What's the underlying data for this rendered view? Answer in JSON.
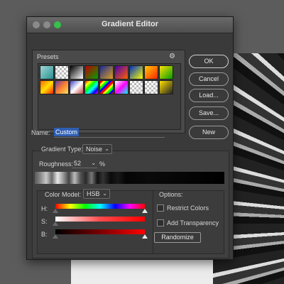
{
  "dialog": {
    "title": "Gradient Editor"
  },
  "presets": {
    "label": "Presets",
    "swatches": [
      {
        "name": "swatch-1",
        "bg": "linear-gradient(135deg,#9fd8d8,#2a9090)"
      },
      {
        "name": "swatch-2",
        "bg": "repeating-conic-gradient(#bbb 0 25%,#fff 0 50%) 0 0/6px 6px"
      },
      {
        "name": "swatch-3",
        "bg": "linear-gradient(135deg,#000,#fff)"
      },
      {
        "name": "swatch-4",
        "bg": "linear-gradient(135deg,#c00000,#00a000)"
      },
      {
        "name": "swatch-5",
        "bg": "linear-gradient(135deg,#1a2a90,#e0a020)"
      },
      {
        "name": "swatch-6",
        "bg": "linear-gradient(135deg,#4a00b0,#ff6000)"
      },
      {
        "name": "swatch-7",
        "bg": "linear-gradient(135deg,#0030c0,#ffff00)"
      },
      {
        "name": "swatch-8",
        "bg": "linear-gradient(135deg,#ffcc00,#ff2200)"
      },
      {
        "name": "swatch-9",
        "bg": "linear-gradient(135deg,#ffe000,#00a000)"
      },
      {
        "name": "swatch-10",
        "bg": "linear-gradient(135deg,#ff6600,#ffe000,#ff2200)"
      },
      {
        "name": "swatch-11",
        "bg": "linear-gradient(135deg,#6a3aa0,#ff8030,#ffe060)"
      },
      {
        "name": "swatch-12",
        "bg": "linear-gradient(135deg,#4040c0,#fff,#c04040)"
      },
      {
        "name": "swatch-13",
        "bg": "linear-gradient(135deg,#ff0000,#ffff00,#00ff00,#00ffff,#0000ff,#ff00ff)"
      },
      {
        "name": "swatch-14",
        "bg": "repeating-linear-gradient(135deg,#ff0000 0 3px,#ffff00 3px 6px,#00ff00 6px 9px,#0000ff 9px 12px)"
      },
      {
        "name": "swatch-15",
        "bg": "linear-gradient(135deg,#fff,#ff00ff,#00ffff)"
      },
      {
        "name": "swatch-16",
        "bg": "repeating-conic-gradient(#bbb 0 25%,#fff 0 50%) 0 0/6px 6px"
      },
      {
        "name": "swatch-17",
        "bg": "repeating-conic-gradient(#bbb 0 25%,#fff 0 50%) 0 0/6px 6px"
      },
      {
        "name": "swatch-18",
        "bg": "linear-gradient(135deg,#ffe000,#222)"
      }
    ]
  },
  "buttons": {
    "ok": "OK",
    "cancel": "Cancel",
    "load": "Load...",
    "save": "Save...",
    "new": "New"
  },
  "name": {
    "label": "Name:",
    "value": "Custom"
  },
  "gradient_type": {
    "label": "Gradient Type:",
    "value": "Noise"
  },
  "roughness": {
    "label": "Roughness:",
    "value": "52",
    "unit": "%"
  },
  "color_model": {
    "label": "Color Model:",
    "value": "HSB"
  },
  "channels": {
    "h": "H:",
    "s": "S:",
    "b": "B:"
  },
  "options": {
    "label": "Options:",
    "restrict_colors": "Restrict Colors",
    "add_transparency": "Add Transparency",
    "randomize": "Randomize"
  }
}
